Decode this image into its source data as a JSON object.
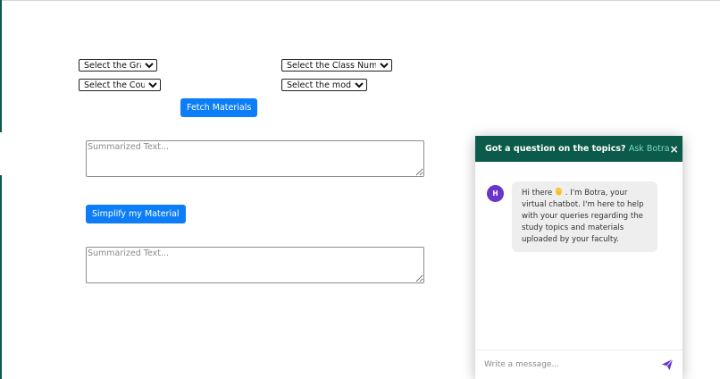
{
  "form": {
    "grade_select": {
      "selected": "Select the Grade"
    },
    "class_number_select": {
      "selected": "Select the Class Number"
    },
    "course_select": {
      "selected": "Select the Course"
    },
    "module_select": {
      "selected": "Select the module"
    },
    "fetch_button_label": "Fetch Materials",
    "summary_placeholder": "Summarized Text...",
    "simplify_button_label": "Simplify my Material",
    "simplified_placeholder": "Summarized Text..."
  },
  "chatbot": {
    "header_title": "Got a question on the topics?",
    "header_accent": "Ask Botra",
    "close_label": "×",
    "avatar_initial": "H",
    "greeting_before_wave": "Hi there ",
    "wave_icon": "waving-hand-icon",
    "greeting_after_wave": " . I'm Botra, your virtual chatbot. I'm here to help with your queries regarding the study topics and materials uploaded by your faculty.",
    "input_placeholder": "Write a message...",
    "send_icon": "send-icon"
  },
  "colors": {
    "primary_button": "#0d7ef7",
    "chat_header": "#0b5a4a",
    "chat_accent": "#7fd9c4",
    "avatar": "#6a35c8",
    "send_icon": "#6a35c8"
  }
}
